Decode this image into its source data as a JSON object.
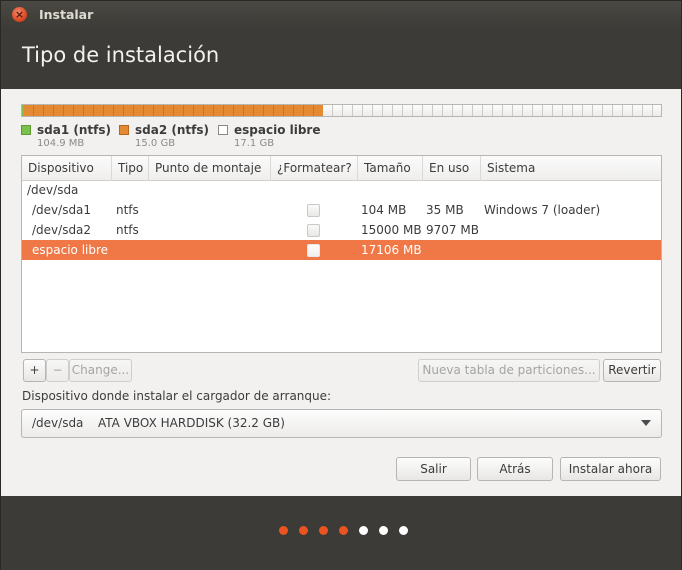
{
  "window": {
    "title": "Instalar"
  },
  "header": {
    "title": "Tipo de instalación"
  },
  "partition_bar": {
    "segments": [
      {
        "name": "sda1 (ntfs)",
        "fraction": 0.003,
        "color": "#7ac04a"
      },
      {
        "name": "sda2 (ntfs)",
        "fraction": 0.466,
        "color": "#e38a33"
      },
      {
        "name": "espacio libre",
        "fraction": 0.531,
        "color": "#f8f8f8"
      }
    ]
  },
  "legend": [
    {
      "name": "sda1 (ntfs)",
      "size": "104.9 MB",
      "color": "#7ac04a"
    },
    {
      "name": "sda2 (ntfs)",
      "size": "15.0 GB",
      "color": "#e38a33"
    },
    {
      "name": "espacio libre",
      "size": "17.1 GB",
      "color": "#ffffff"
    }
  ],
  "table": {
    "columns": [
      "Dispositivo",
      "Tipo",
      "Punto de montaje",
      "¿Formatear?",
      "Tamaño",
      "En uso",
      "Sistema"
    ],
    "rows": [
      {
        "device": "/dev/sda",
        "type": "",
        "mount": "",
        "format": null,
        "size": "",
        "used": "",
        "system": ""
      },
      {
        "device": "/dev/sda1",
        "type": "ntfs",
        "mount": "",
        "format": false,
        "size": "104 MB",
        "used": "35 MB",
        "system": "Windows 7 (loader)"
      },
      {
        "device": "/dev/sda2",
        "type": "ntfs",
        "mount": "",
        "format": false,
        "size": "15000 MB",
        "used": "9707 MB",
        "system": ""
      },
      {
        "device": "espacio libre",
        "type": "",
        "mount": "",
        "format": false,
        "size": "17106 MB",
        "used": "",
        "system": "",
        "selected": true
      }
    ]
  },
  "partition_buttons": {
    "add": "+",
    "remove": "−",
    "change": "Change...",
    "new_table": "Nueva tabla de particiones...",
    "revert": "Revertir"
  },
  "bootloader": {
    "label": "Dispositivo donde instalar el cargador de arranque:",
    "device": "/dev/sda",
    "disk": "ATA VBOX HARDDISK (32.2 GB)"
  },
  "actions": {
    "quit": "Salir",
    "back": "Atrás",
    "install": "Instalar ahora"
  },
  "progress": {
    "total_steps": 7,
    "completed_steps": 4,
    "active_color": "#e95420",
    "inactive_color": "#ffffff"
  }
}
